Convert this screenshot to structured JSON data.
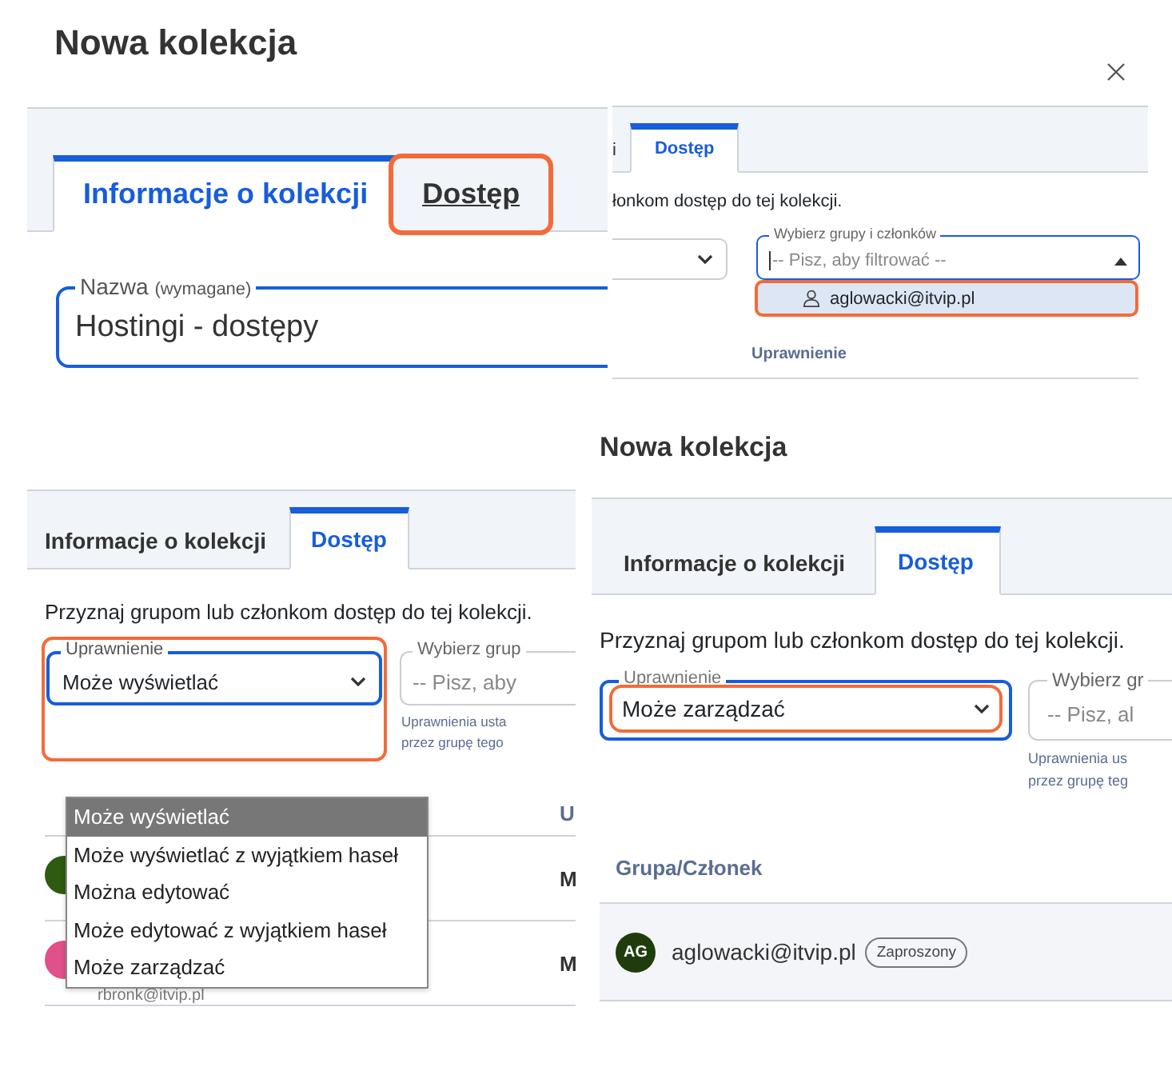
{
  "panels": [
    {
      "kind": "info",
      "title": "Nowa kolekcja",
      "tabs": [
        {
          "label": "Informacje o kolekcji",
          "selected": true,
          "highlighted": false
        },
        {
          "label": "Dostęp",
          "selected": false,
          "highlighted": true
        }
      ],
      "name_field": {
        "label": "Nazwa",
        "hint": "(wymagane)",
        "value": "Hostingi - dostępy"
      }
    },
    {
      "kind": "member_search",
      "tabs": [
        {
          "label": "i",
          "selected": false
        },
        {
          "label": "Dostęp",
          "selected": true
        }
      ],
      "intro": "łonkom dostęp do tej kolekcji.",
      "member_field": {
        "label": "Wybierz grupy i członków",
        "placeholder": "-- Pisz, aby filtrować --"
      },
      "options": [
        {
          "label": "aglowacki@itvip.pl",
          "highlighted": true
        }
      ],
      "column_header": "Uprawnienie"
    },
    {
      "kind": "permission_menu",
      "tabs": [
        {
          "label": "Informacje o kolekcji",
          "selected": false
        },
        {
          "label": "Dostęp",
          "selected": true
        }
      ],
      "intro": "Przyznaj grupom lub członkom dostęp do tej kolekcji.",
      "permission_field": {
        "label": "Uprawnienie",
        "value": "Może wyświetlać",
        "highlighted": true
      },
      "member_field": {
        "label": "Wybierz grup",
        "placeholder": "-- Pisz, aby"
      },
      "hint_lines": [
        "Uprawnienia usta",
        "przez grupę tego"
      ],
      "column_header": "U",
      "rows": [
        {
          "email": "",
          "permission": "M",
          "color": "#2f5a12"
        },
        {
          "email": "rbronk@itvip.pl",
          "permission": "M",
          "color": "#e0508a"
        }
      ],
      "menu": [
        {
          "label": "Może wyświetlać",
          "selected": true
        },
        {
          "label": "Może wyświetlać z wyjątkiem haseł",
          "selected": false
        },
        {
          "label": "Można edytować",
          "selected": false
        },
        {
          "label": "Może edytować z wyjątkiem haseł",
          "selected": false
        },
        {
          "label": "Może zarządzać",
          "selected": false
        }
      ]
    },
    {
      "kind": "permission_set",
      "title": "Nowa kolekcja",
      "tabs": [
        {
          "label": "Informacje o kolekcji",
          "selected": false
        },
        {
          "label": "Dostęp",
          "selected": true
        }
      ],
      "intro": "Przyznaj grupom lub członkom dostęp do tej kolekcji.",
      "permission_field": {
        "label": "Uprawnienie",
        "value": "Może zarządzać",
        "highlighted": true
      },
      "member_field": {
        "label": "Wybierz gr",
        "placeholder": "-- Pisz, al"
      },
      "hint_lines": [
        "Uprawnienia us",
        "przez grupę teg"
      ],
      "column_header": "Grupa/Członek",
      "rows": [
        {
          "initials": "AG",
          "email": "aglowacki@itvip.pl",
          "badge": "Zaproszony"
        }
      ]
    }
  ]
}
